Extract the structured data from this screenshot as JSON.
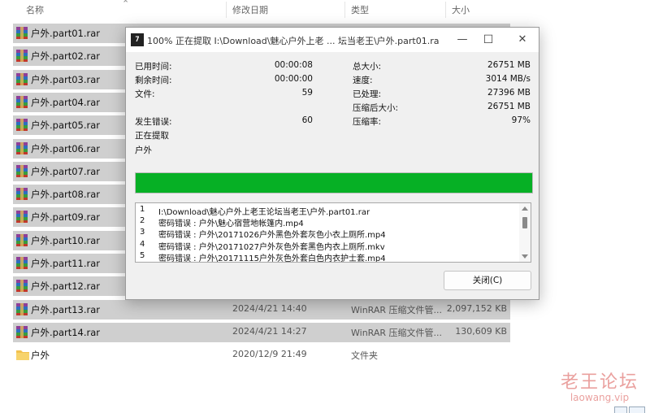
{
  "explorer": {
    "columns": {
      "name": "名称",
      "date": "修改日期",
      "type": "类型",
      "size": "大小"
    },
    "rows": [
      {
        "name": "户外.part01.rar",
        "date": "",
        "type": "",
        "size": "",
        "selected": true
      },
      {
        "name": "户外.part02.rar",
        "date": "",
        "type": "",
        "size": "",
        "selected": true
      },
      {
        "name": "户外.part03.rar",
        "date": "",
        "type": "",
        "size": "",
        "selected": true
      },
      {
        "name": "户外.part04.rar",
        "date": "",
        "type": "",
        "size": "",
        "selected": true
      },
      {
        "name": "户外.part05.rar",
        "date": "",
        "type": "",
        "size": "",
        "selected": true
      },
      {
        "name": "户外.part06.rar",
        "date": "",
        "type": "",
        "size": "",
        "selected": true
      },
      {
        "name": "户外.part07.rar",
        "date": "",
        "type": "",
        "size": "",
        "selected": true
      },
      {
        "name": "户外.part08.rar",
        "date": "",
        "type": "",
        "size": "",
        "selected": true
      },
      {
        "name": "户外.part09.rar",
        "date": "",
        "type": "",
        "size": "",
        "selected": true
      },
      {
        "name": "户外.part10.rar",
        "date": "",
        "type": "",
        "size": "",
        "selected": true
      },
      {
        "name": "户外.part11.rar",
        "date": "",
        "type": "",
        "size": "",
        "selected": true
      },
      {
        "name": "户外.part12.rar",
        "date": "",
        "type": "",
        "size": "",
        "selected": true
      },
      {
        "name": "户外.part13.rar",
        "date": "2024/4/21 14:40",
        "type": "WinRAR 压缩文件管...",
        "size": "2,097,152 KB",
        "selected": true
      },
      {
        "name": "户外.part14.rar",
        "date": "2024/4/21 14:27",
        "type": "WinRAR 压缩文件管...",
        "size": "130,609 KB",
        "selected": true
      },
      {
        "name": "户外",
        "date": "2020/12/9 21:49",
        "type": "文件夹",
        "size": "",
        "selected": false,
        "folder": true
      }
    ]
  },
  "dialog": {
    "app_icon": "7",
    "title": "100% 正在提取 I:\\Download\\魅心户外上老 ... 坛当老王\\户外.part01.rar",
    "elapsed_label": "已用时间:",
    "elapsed_value": "00:00:08",
    "remaining_label": "剩余时间:",
    "remaining_value": "00:00:00",
    "files_label": "文件:",
    "files_value": "59",
    "errors_label": "发生错误:",
    "errors_value": "60",
    "extracting_label": "正在提取",
    "current_item": "户外",
    "total_size_label": "总大小:",
    "total_size_value": "26751 MB",
    "speed_label": "速度:",
    "speed_value": "3014 MB/s",
    "processed_label": "已处理:",
    "processed_value": "27396 MB",
    "compressed_size_label": "压缩后大小:",
    "compressed_size_value": "26751 MB",
    "ratio_label": "压缩率:",
    "ratio_value": "97%",
    "progress_fraction": 1.0,
    "progress_color": "#06b025",
    "log": [
      {
        "num": "1",
        "msg": "I:\\Download\\魅心户外上老王论坛当老王\\户外.part01.rar"
      },
      {
        "num": "2",
        "msg": "密码错误 : 户外\\魅心宿营地帐篷内.mp4"
      },
      {
        "num": "3",
        "msg": "密码错误 : 户外\\20171026户外黑色外套灰色小衣上厕所.mp4"
      },
      {
        "num": "4",
        "msg": "密码错误 : 户外\\20171027户外灰色外套黑色内衣上厕所.mkv"
      },
      {
        "num": "5",
        "msg": "密码错误 : 户外\\20171115户外灰色外套白色内衣护士套.mp4"
      }
    ],
    "close_button": "关闭(C)",
    "minimize_glyph": "—",
    "maximize_glyph": "☐",
    "close_glyph": "✕"
  },
  "watermark": {
    "title": "老王论坛",
    "subtitle": "laowang.vip"
  },
  "icons": {
    "rar_file": "winrar-archive-icon",
    "folder": "folder-icon",
    "folder_color": "#f2c14e"
  }
}
